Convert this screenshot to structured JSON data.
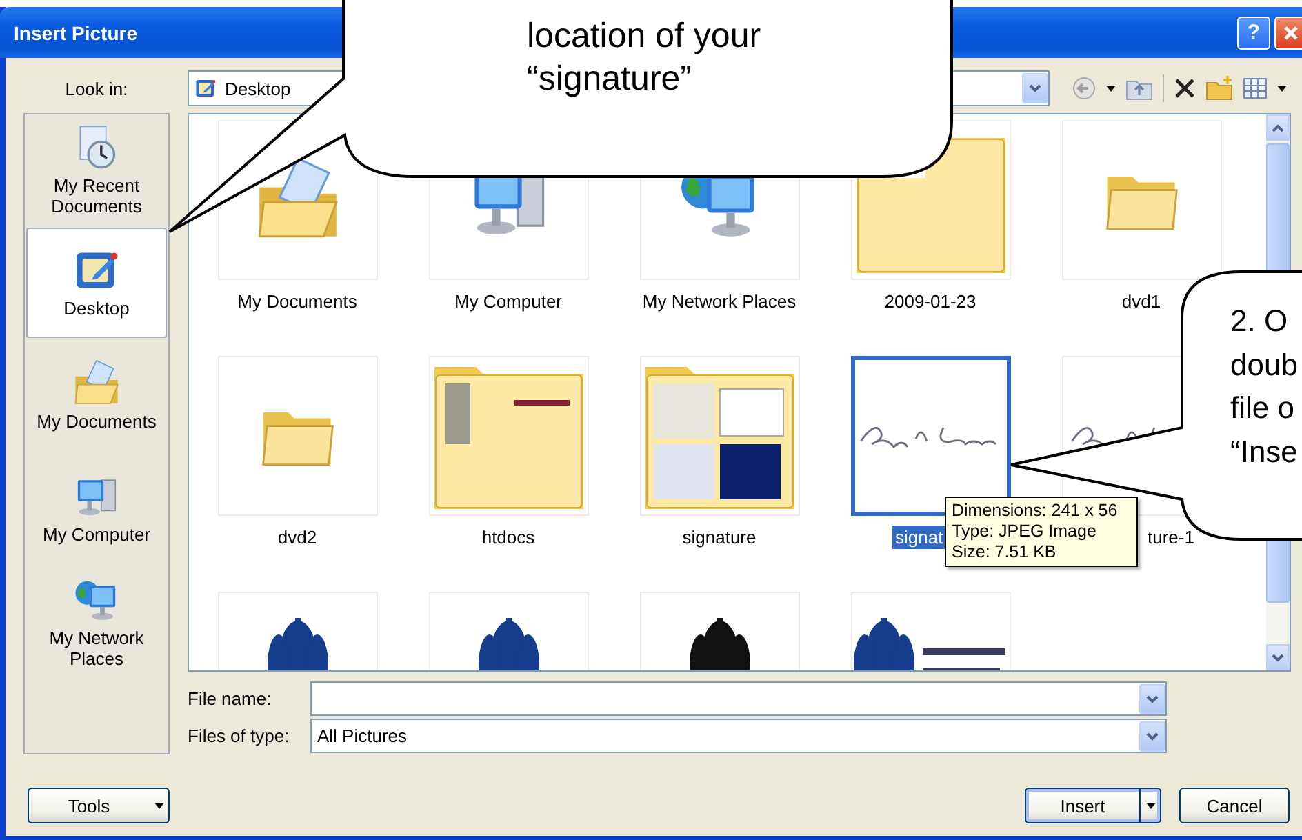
{
  "window": {
    "title": "Insert Picture",
    "help": "?"
  },
  "look_in": {
    "label": "Look in:",
    "value": "Desktop"
  },
  "places": [
    {
      "label": "My Recent Documents",
      "kind": "recent",
      "selected": false
    },
    {
      "label": "Desktop",
      "kind": "desktop",
      "selected": true
    },
    {
      "label": "My Documents",
      "kind": "documents",
      "selected": false
    },
    {
      "label": "My Computer",
      "kind": "computer",
      "selected": false
    },
    {
      "label": "My Network Places",
      "kind": "network",
      "selected": false
    }
  ],
  "files": [
    {
      "label": "My Documents",
      "kind": "documents",
      "selected": false
    },
    {
      "label": "My Computer",
      "kind": "computer",
      "selected": false
    },
    {
      "label": "My Network Places",
      "kind": "network",
      "selected": false
    },
    {
      "label": "2009-01-23",
      "kind": "preview-folder",
      "selected": false
    },
    {
      "label": "dvd1",
      "kind": "folder",
      "selected": false
    },
    {
      "label": "dvd2",
      "kind": "folder",
      "selected": false
    },
    {
      "label": "htdocs",
      "kind": "preview-folder",
      "selected": false
    },
    {
      "label": "signature",
      "kind": "preview-folder",
      "selected": false
    },
    {
      "label": "signat",
      "kind": "picture",
      "selected": true
    },
    {
      "label": "ture-1",
      "kind": "picture",
      "selected": false
    },
    {
      "kind": "picture",
      "selected": false
    },
    {
      "kind": "picture",
      "selected": false
    },
    {
      "kind": "picture",
      "selected": false
    },
    {
      "kind": "picture",
      "selected": false
    }
  ],
  "file_name": {
    "label": "File name:"
  },
  "file_type": {
    "label": "Files of type:",
    "value": "All Pictures"
  },
  "buttons": [
    {
      "label": "Tools",
      "kind": "menu"
    },
    {
      "label": "Insert",
      "kind": "split"
    },
    {
      "label": "Cancel",
      "kind": "plain"
    }
  ],
  "tooltip": [
    "Dimensions: 241 x 56",
    "Type: JPEG Image",
    "Size: 7.51 KB"
  ],
  "callouts": [
    {
      "lines": [
        "location of your",
        "“signature”"
      ]
    },
    {
      "lines": [
        "2. O",
        "doub",
        "file o",
        "“Inse"
      ]
    }
  ]
}
